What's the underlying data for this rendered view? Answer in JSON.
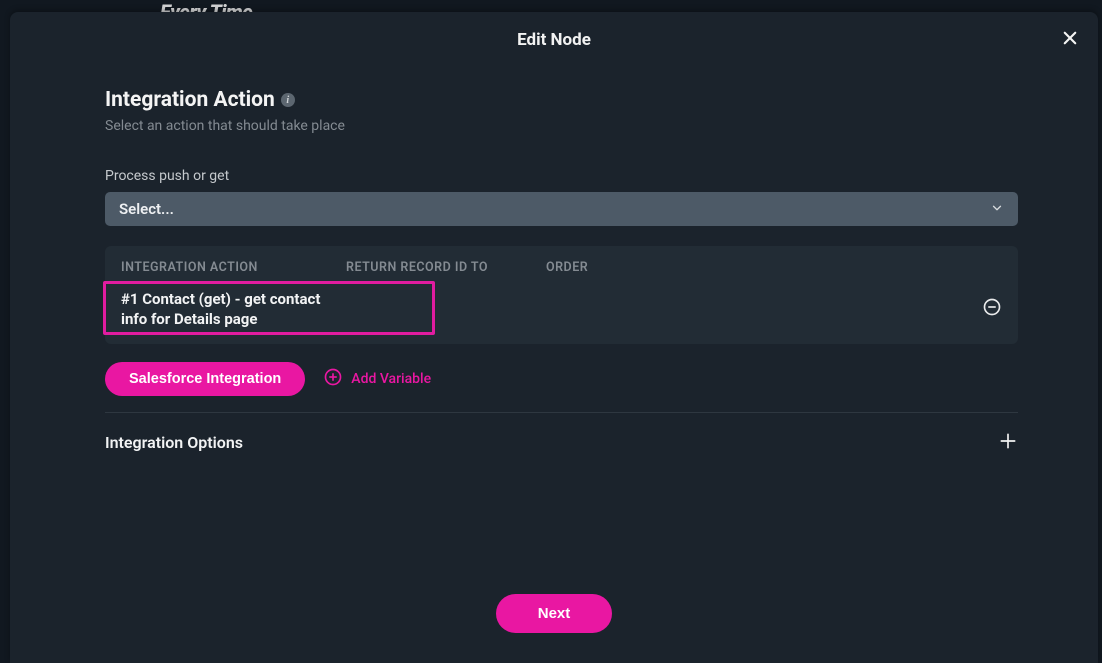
{
  "background_hint": "Every Time",
  "modal": {
    "title": "Edit Node"
  },
  "section": {
    "title": "Integration Action",
    "subtitle": "Select an action that should take place"
  },
  "field": {
    "label": "Process push or get",
    "placeholder": "Select..."
  },
  "table": {
    "headers": {
      "action": "INTEGRATION ACTION",
      "return": "RETURN RECORD ID TO",
      "order": "ORDER"
    },
    "row": {
      "action": "#1 Contact (get) - get contact info for Details page"
    }
  },
  "buttons": {
    "salesforce": "Salesforce Integration",
    "add_variable": "Add Variable",
    "next": "Next"
  },
  "options": {
    "label": "Integration Options"
  }
}
